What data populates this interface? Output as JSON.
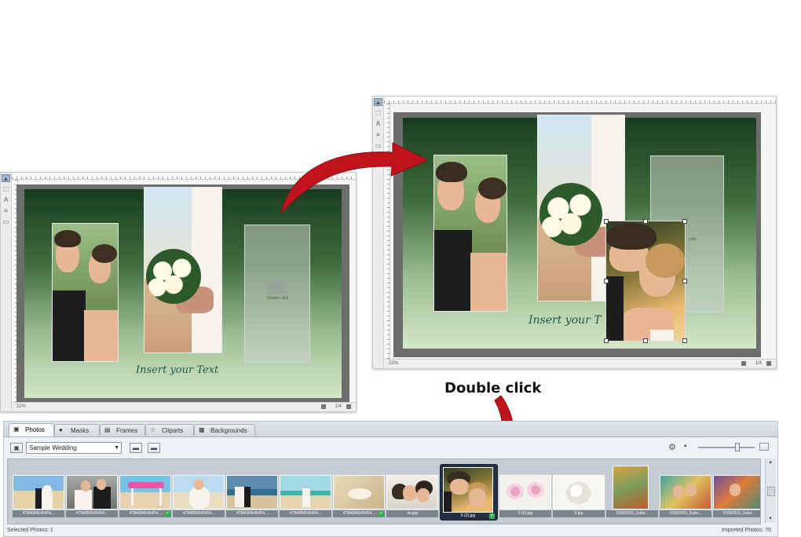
{
  "editor_small": {
    "zoom_label": "22%",
    "page_label": "1/4",
    "insert_text": "Insert your Text",
    "placeholder_text": "Double click"
  },
  "editor_big": {
    "zoom_label": "22%",
    "page_label": "1/4",
    "insert_text": "Insert your T",
    "placeholder_text": "click"
  },
  "annotation": {
    "double_click_label": "Double click"
  },
  "panel": {
    "tabs": [
      {
        "label": "Photos",
        "icon": "photo-icon",
        "active": true
      },
      {
        "label": "Masks",
        "icon": "mask-icon",
        "active": false
      },
      {
        "label": "Frames",
        "icon": "frame-icon",
        "active": false
      },
      {
        "label": "Cliparts",
        "icon": "star-icon",
        "active": false
      },
      {
        "label": "Backgrounds",
        "icon": "background-icon",
        "active": false
      }
    ],
    "album_select": "Sample Wedding",
    "thumbnails": [
      {
        "caption": "4784684645454...",
        "checked": false
      },
      {
        "caption": "4784684645454...",
        "checked": false
      },
      {
        "caption": "4784684645454...",
        "checked": true
      },
      {
        "caption": "4784684645454...",
        "checked": false
      },
      {
        "caption": "4784684645454...",
        "checked": false
      },
      {
        "caption": "4784684645454...",
        "checked": false
      },
      {
        "caption": "4784684645454...",
        "checked": true
      },
      {
        "caption": "4a.jpg",
        "checked": false
      },
      {
        "caption": "5 (2).jpg",
        "checked": true,
        "selected": true
      },
      {
        "caption": "5 (3).jpg",
        "checked": false
      },
      {
        "caption": "5.jpg",
        "checked": false
      },
      {
        "caption": "51582933_Subs...",
        "checked": false
      },
      {
        "caption": "51582933_Subs...",
        "checked": false
      },
      {
        "caption": "51582933_Subs...",
        "checked": false
      }
    ],
    "footer_left": "Selected Photos: 1",
    "footer_right": "Imported Photos: 70"
  },
  "colors": {
    "arrow_red": "#c0131b",
    "page_dark_green": "#173d1f",
    "page_light_green": "#d4e8c8",
    "check_green": "#33b34a"
  }
}
